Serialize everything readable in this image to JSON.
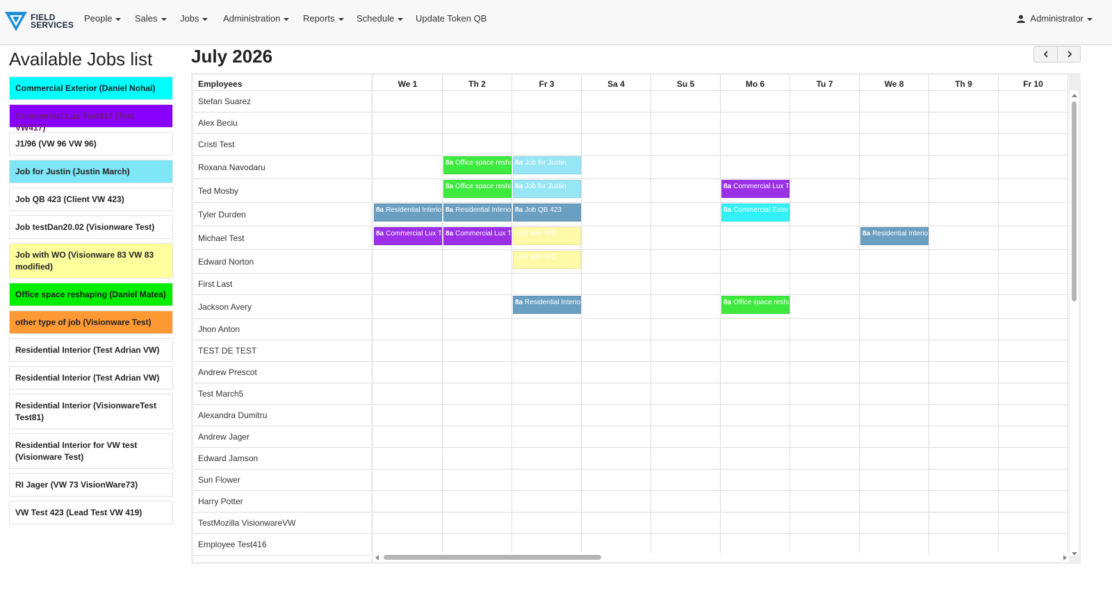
{
  "brand": {
    "line1": "FIELD",
    "line2": "SERVICES"
  },
  "nav": {
    "people": "People",
    "sales": "Sales",
    "jobs": "Jobs",
    "administration": "Administration",
    "reports": "Reports",
    "schedule": "Schedule",
    "update_token": "Update Token QB",
    "user": "Administrator"
  },
  "sidebar": {
    "title": "Available Jobs list",
    "jobs": [
      {
        "label": "Commercial Exterior (Daniel Nohai)",
        "color": "#00ffff",
        "text_color": "#222222"
      },
      {
        "label": "Commercial Lux Test417 (Test VW417)",
        "color": "#8a00ff",
        "text_color": "#6a1d6a"
      },
      {
        "label": "J1/96 (VW 96 VW 96)",
        "color": "#ffffff",
        "text_color": "#222222"
      },
      {
        "label": "Job for Justin (Justin March)",
        "color": "#7fe6f5",
        "text_color": "#222222"
      },
      {
        "label": "Job QB 423 (Client VW 423)",
        "color": "#ffffff",
        "text_color": "#222222"
      },
      {
        "label": "Job testDan20.02 (Visionware Test)",
        "color": "#ffffff",
        "text_color": "#222222"
      },
      {
        "label": "Job with WO (Visionware 83 VW 83 modified)",
        "color": "#ffff9e",
        "text_color": "#222222"
      },
      {
        "label": "Office space reshaping (Daniel Matea)",
        "color": "#00ee00",
        "text_color": "#222222"
      },
      {
        "label": "other type of job (Visionware Test)",
        "color": "#ff9933",
        "text_color": "#222222"
      },
      {
        "label": "Residential Interior (Test Adrian VW)",
        "color": "#ffffff",
        "text_color": "#222222"
      },
      {
        "label": "Residential Interior (Test Adrian VW)",
        "color": "#ffffff",
        "text_color": "#222222"
      },
      {
        "label": "Residential Interior (VisionwareTest Test81)",
        "color": "#ffffff",
        "text_color": "#222222"
      },
      {
        "label": "Residential Interior for VW test (Visionware Test)",
        "color": "#ffffff",
        "text_color": "#222222"
      },
      {
        "label": "RI Jager (VW 73 VisionWare73)",
        "color": "#ffffff",
        "text_color": "#222222"
      },
      {
        "label": "VW Test 423 (Lead Test VW 419)",
        "color": "#ffffff",
        "text_color": "#222222"
      }
    ]
  },
  "calendar": {
    "title": "July 2026",
    "prev_label": "‹",
    "next_label": "›",
    "resource_header": "Employees",
    "days": [
      "We 1",
      "Th 2",
      "Fr 3",
      "Sa 4",
      "Su 5",
      "Mo 6",
      "Tu 7",
      "We 8",
      "Th 9",
      "Fr 10"
    ],
    "employees": [
      "Stefan Suarez",
      "Alex Beciu",
      "Cristi Test",
      "Roxana Navodaru",
      "Ted Mosby",
      "Tyler Durden",
      "Michael Test",
      "Edward Norton",
      "First Last",
      "Jackson Avery",
      "Jhon Anton",
      "TEST DE TEST",
      "Andrew Prescot",
      "Test March5",
      "Alexandra Dumitru",
      "Andrew Jager",
      "Edward Jamson",
      "Sun Flower",
      "Harry Potter",
      "TestMozilla VisionwareVW",
      "Employee Test416"
    ],
    "events": [
      {
        "row": 3,
        "day": 1,
        "time": "8a",
        "title": "Office space resha",
        "color": "#3dea3d",
        "text_color": "#ffffff"
      },
      {
        "row": 3,
        "day": 2,
        "time": "8a",
        "title": "Job for Justin",
        "color": "#97e6f5",
        "text_color": "#ffffff"
      },
      {
        "row": 4,
        "day": 1,
        "time": "8a",
        "title": "Office space resha",
        "color": "#3dea3d",
        "text_color": "#ffffff"
      },
      {
        "row": 4,
        "day": 2,
        "time": "8a",
        "title": "Job for Justin",
        "color": "#97e6f5",
        "text_color": "#ffffff"
      },
      {
        "row": 4,
        "day": 5,
        "time": "8a",
        "title": "Commercial Lux Te",
        "color": "#9b30e6",
        "text_color": "#ffffff"
      },
      {
        "row": 5,
        "day": 0,
        "time": "8a",
        "title": "Residential Interior",
        "color": "#6a9fc2",
        "text_color": "#ffffff"
      },
      {
        "row": 5,
        "day": 1,
        "time": "8a",
        "title": "Residential Interior",
        "color": "#6a9fc2",
        "text_color": "#ffffff"
      },
      {
        "row": 5,
        "day": 2,
        "time": "8a",
        "title": "Job QB 423",
        "color": "#6a9fc2",
        "text_color": "#ffffff"
      },
      {
        "row": 5,
        "day": 5,
        "time": "8a",
        "title": "Commercial Exteri",
        "color": "#33f0f5",
        "text_color": "#ffffff"
      },
      {
        "row": 6,
        "day": 0,
        "time": "8a",
        "title": "Commercial Lux Te",
        "color": "#9b30e6",
        "text_color": "#ffffff"
      },
      {
        "row": 6,
        "day": 1,
        "time": "8a",
        "title": "Commercial Lux Te",
        "color": "#9b30e6",
        "text_color": "#ffffff"
      },
      {
        "row": 6,
        "day": 2,
        "time": "",
        "title": "Job with WO",
        "color": "#fffaa8",
        "text_color": "#ffffff"
      },
      {
        "row": 6,
        "day": 7,
        "time": "8a",
        "title": "Residential Interior",
        "color": "#6a9fc2",
        "text_color": "#ffffff"
      },
      {
        "row": 7,
        "day": 2,
        "time": "",
        "title": "Job with WO",
        "color": "#fffaa8",
        "text_color": "#ffffff"
      },
      {
        "row": 9,
        "day": 2,
        "time": "8a",
        "title": "Residential Interior",
        "color": "#6a9fc2",
        "text_color": "#ffffff"
      },
      {
        "row": 9,
        "day": 5,
        "time": "8a",
        "title": "Office space resha",
        "color": "#3dea3d",
        "text_color": "#ffffff"
      }
    ]
  },
  "colors": {
    "navbar_bg": "#f8f8f8",
    "grid_line": "#dddddd",
    "accent": "#1e90d6"
  }
}
